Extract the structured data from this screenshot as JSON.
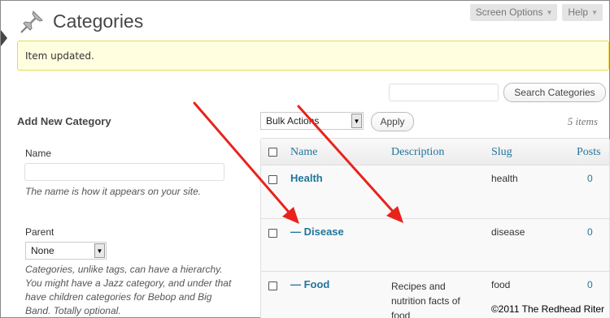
{
  "header": {
    "title": "Categories",
    "screen_options": "Screen Options",
    "help": "Help"
  },
  "notice": {
    "message": "Item updated."
  },
  "search": {
    "button": "Search Categories",
    "value": ""
  },
  "form": {
    "heading": "Add New Category",
    "name_label": "Name",
    "name_value": "",
    "name_help": "The name is how it appears on your site.",
    "parent_label": "Parent",
    "parent_selected": "None",
    "parent_help": "Categories, unlike tags, can have a hierarchy. You might have a Jazz category, and under that have children categories for Bebop and Big Band. Totally optional."
  },
  "bulk": {
    "selected": "Bulk Actions",
    "apply": "Apply",
    "count": "5 items"
  },
  "table": {
    "columns": {
      "name": "Name",
      "description": "Description",
      "slug": "Slug",
      "posts": "Posts"
    },
    "rows": [
      {
        "name": "Health",
        "description": "",
        "slug": "health",
        "posts": "0"
      },
      {
        "name": "— Disease",
        "description": "",
        "slug": "disease",
        "posts": "0"
      },
      {
        "name": "— Food",
        "description": "Recipes and nutrition facts of food",
        "slug": "food",
        "posts": "0"
      }
    ]
  },
  "annotations": {
    "arrow_color": "#e8231c"
  },
  "footer": {
    "copyright": "©2011 The Redhead Riter"
  },
  "colors": {
    "link": "#21759b",
    "notice_bg": "#ffffe0",
    "notice_border": "#e6db55"
  }
}
